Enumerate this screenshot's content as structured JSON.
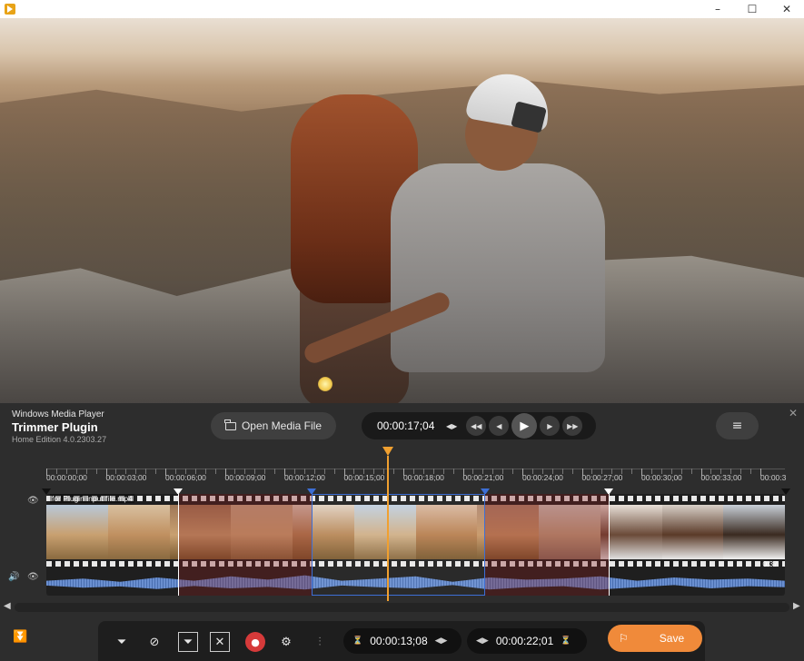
{
  "window": {
    "minimize": "–",
    "maximize": "☐",
    "close": "✕"
  },
  "brand": {
    "line1": "Windows Media Player",
    "line2": "Trimmer Plugin",
    "line3": "Home Edition 4.0.2303.27"
  },
  "toolbar_top": {
    "open_label": "Open Media File",
    "current_time": "00:00:17;04",
    "close_panel": "✕"
  },
  "timeline": {
    "ticks": [
      "00:00:00;00",
      "00:00:03;00",
      "00:00:06;00",
      "00:00:09;00",
      "00:00:12;00",
      "00:00:15;00",
      "00:00:18;00",
      "00:00:21;00",
      "00:00:24;00",
      "00:00:27;00",
      "00:00:30;00",
      "00:00:33;00",
      "00:00:3"
    ],
    "clip_name": "for Plugin input file.mp4",
    "duration": "0:37"
  },
  "bottom": {
    "start_time": "00:00:13;08",
    "end_time": "00:00:22;01",
    "save_label": "Save"
  },
  "colors": {
    "accent": "#f08a3a",
    "playhead": "#f0a030",
    "selection": "#3d6fd6",
    "record": "#d63a3a"
  }
}
